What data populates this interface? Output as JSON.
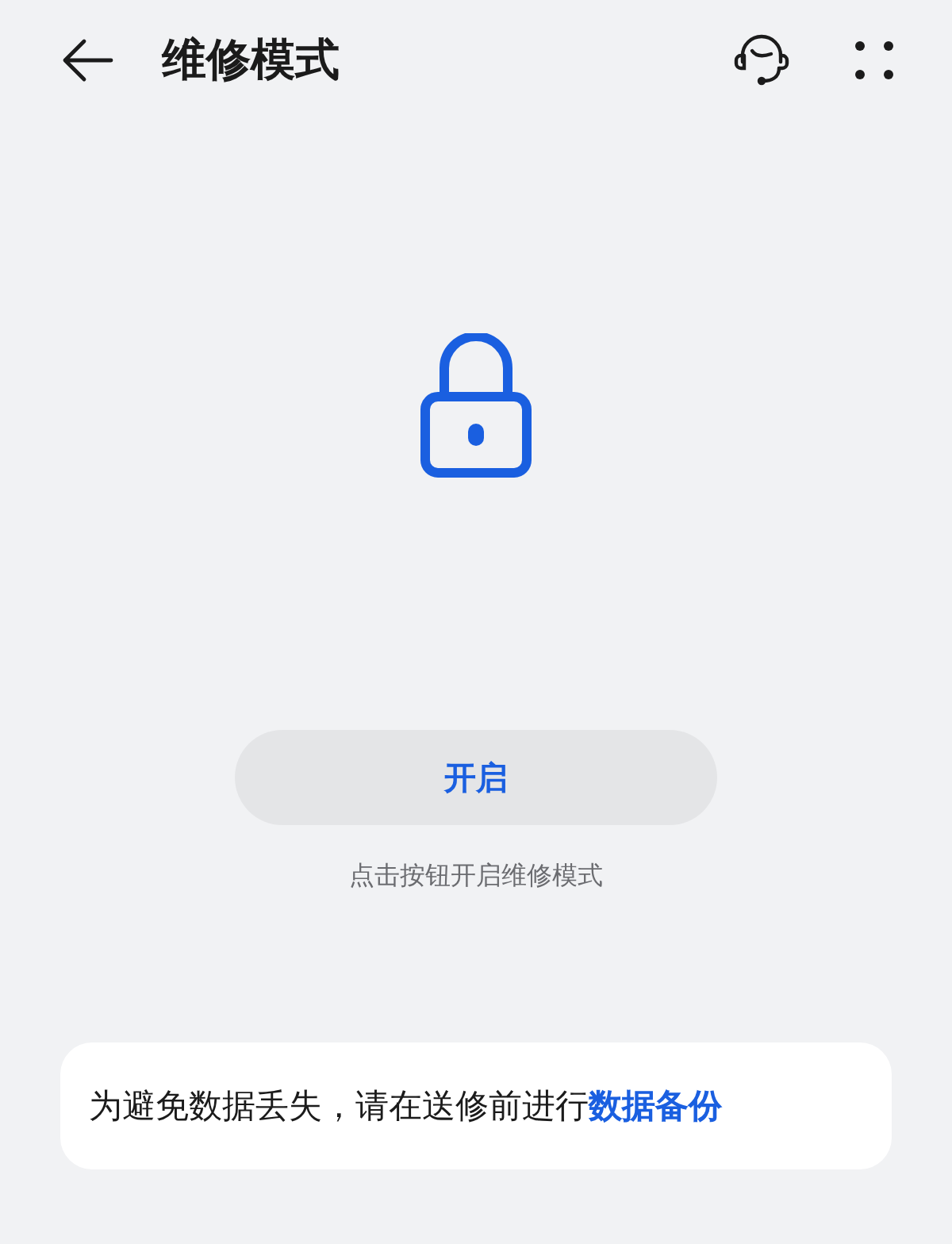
{
  "header": {
    "title": "维修模式"
  },
  "action_button": {
    "label": "开启"
  },
  "hint": "点击按钮开启维修模式",
  "notice": {
    "text": "为避免数据丢失，请在送修前进行",
    "link": "数据备份"
  }
}
